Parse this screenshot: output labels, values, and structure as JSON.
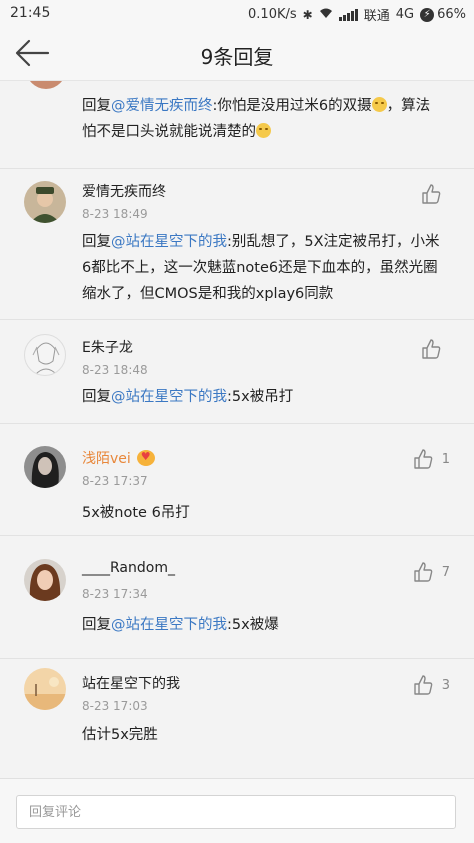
{
  "status_bar": {
    "time": "21:45",
    "net_speed": "0.10K/s",
    "carrier": "联通",
    "network": "4G",
    "battery": "66%"
  },
  "header": {
    "title": "9条回复"
  },
  "comments": [
    {
      "reply_prefix": "回复",
      "mention": "@爱情无疾而终",
      "text": ":你怕是没用过米6的双摄",
      "text_2": "，算法怕不是口头说就能说清楚的"
    },
    {
      "username": "爱情无疾而终",
      "time": "8-23 18:49",
      "reply_prefix": "回复",
      "mention": "@站在星空下的我",
      "text": ":别乱想了，5X注定被吊打，小米6都比不上，这一次魅蓝note6还是下血本的，虽然光圈缩水了，但CMOS是和我的xplay6同款",
      "likes": ""
    },
    {
      "username": "E朱子龙",
      "time": "8-23 18:48",
      "reply_prefix": "回复",
      "mention": "@站在星空下的我",
      "text": ":5x被吊打",
      "likes": ""
    },
    {
      "username": "浅陌vei",
      "time": "8-23 17:37",
      "text": "5x被note 6吊打",
      "likes": "1"
    },
    {
      "username": "____Random_",
      "time": "8-23 17:34",
      "reply_prefix": "回复",
      "mention": "@站在星空下的我",
      "text": ":5x被爆",
      "likes": "7"
    },
    {
      "username": "站在星空下的我",
      "time": "8-23 17:03",
      "text": "估计5x完胜",
      "likes": "3"
    }
  ],
  "composer": {
    "placeholder": "回复评论"
  }
}
